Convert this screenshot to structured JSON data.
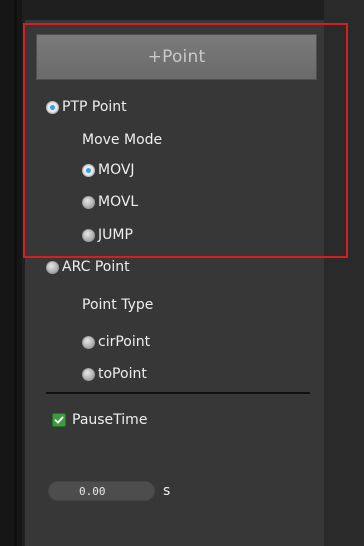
{
  "add_point": {
    "label": "+Point"
  },
  "point_kind": {
    "ptp": {
      "label": "PTP Point",
      "checked": true
    },
    "move_mode_label": "Move Mode",
    "move_modes": [
      {
        "label": "MOVJ",
        "checked": true
      },
      {
        "label": "MOVL",
        "checked": false
      },
      {
        "label": "JUMP",
        "checked": false
      }
    ],
    "arc": {
      "label": "ARC Point",
      "checked": false
    },
    "point_type_label": "Point Type",
    "point_types": [
      {
        "label": "cirPoint",
        "checked": false
      },
      {
        "label": "toPoint",
        "checked": false
      }
    ]
  },
  "pause_time": {
    "label": "PauseTime",
    "checked": true,
    "value": "0.00",
    "unit": "s"
  },
  "colors": {
    "accent_blue": "#3aa0f0",
    "highlight_red": "#d21f1f",
    "checkbox_green": "#3e9b3e"
  }
}
